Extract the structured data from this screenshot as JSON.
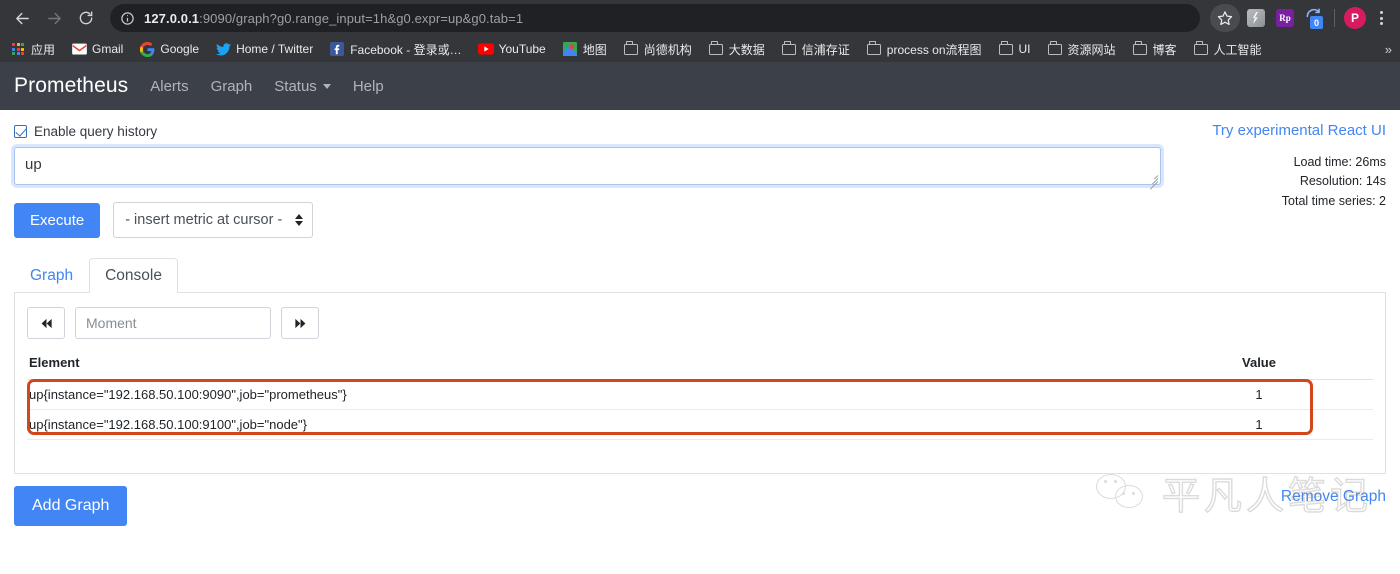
{
  "browser": {
    "back_icon": "arrow-left",
    "forward_icon": "arrow-right",
    "reload_icon": "reload",
    "info_icon": "info-circle",
    "url_host": "127.0.0.1",
    "url_rest": ":9090/graph?g0.range_input=1h&g0.expr=up&g0.tab=1",
    "star_icon": "star-outline",
    "ext_grey_icon": "lightning-extension-icon",
    "ext_rp_label": "Rp",
    "sync_badge": "0",
    "avatar_label": "P",
    "menu_icon": "kebab-menu-icon",
    "bookmarks": [
      {
        "label": "应用",
        "icon": "apps-grid-icon"
      },
      {
        "label": "Gmail",
        "icon": "gmail-icon"
      },
      {
        "label": "Google",
        "icon": "google-icon"
      },
      {
        "label": "Home / Twitter",
        "icon": "twitter-icon"
      },
      {
        "label": "Facebook - 登录或…",
        "icon": "facebook-icon"
      },
      {
        "label": "YouTube",
        "icon": "youtube-icon"
      },
      {
        "label": "地图",
        "icon": "maps-icon"
      },
      {
        "label": "尚德机构",
        "icon": "folder-icon"
      },
      {
        "label": "大数据",
        "icon": "folder-icon"
      },
      {
        "label": "信浦存证",
        "icon": "folder-icon"
      },
      {
        "label": "process on流程图",
        "icon": "folder-icon"
      },
      {
        "label": "UI",
        "icon": "folder-icon"
      },
      {
        "label": "资源网站",
        "icon": "folder-icon"
      },
      {
        "label": "博客",
        "icon": "folder-icon"
      },
      {
        "label": "人工智能",
        "icon": "folder-icon"
      }
    ],
    "overflow_label": "»"
  },
  "nav": {
    "brand": "Prometheus",
    "items": [
      {
        "label": "Alerts",
        "has_caret": false
      },
      {
        "label": "Graph",
        "has_caret": false
      },
      {
        "label": "Status",
        "has_caret": true
      },
      {
        "label": "Help",
        "has_caret": false
      }
    ]
  },
  "query": {
    "history_label": "Enable query history",
    "history_checked": true,
    "expr_value": "up",
    "execute_label": "Execute",
    "metric_select_value": "- insert metric at cursor -"
  },
  "sidepanel": {
    "try_react_label": "Try experimental React UI",
    "load_time": "Load time: 26ms",
    "resolution": "Resolution: 14s",
    "total_series": "Total time series: 2"
  },
  "tabs": [
    {
      "label": "Graph",
      "active": false
    },
    {
      "label": "Console",
      "active": true
    }
  ],
  "timenav": {
    "prev_icon": "double-chevron-left-icon",
    "next_icon": "double-chevron-right-icon",
    "moment_placeholder": "Moment",
    "moment_value": ""
  },
  "table": {
    "columns": [
      "Element",
      "Value"
    ],
    "rows": [
      {
        "element": "up{instance=\"192.168.50.100:9090\",job=\"prometheus\"}",
        "value": "1"
      },
      {
        "element": "up{instance=\"192.168.50.100:9100\",job=\"node\"}",
        "value": "1"
      }
    ],
    "highlight_color": "#d2471a"
  },
  "footer": {
    "add_graph_label": "Add Graph",
    "remove_graph_label": "Remove Graph"
  },
  "watermark": {
    "text": "平凡人笔记",
    "icon": "wechat-icon"
  },
  "colors": {
    "accent_blue": "#4285f4",
    "nav_bg": "#3c4049",
    "chrome_bg": "#35363a",
    "omnibox_bg": "#202124",
    "highlight": "#d2471a"
  }
}
